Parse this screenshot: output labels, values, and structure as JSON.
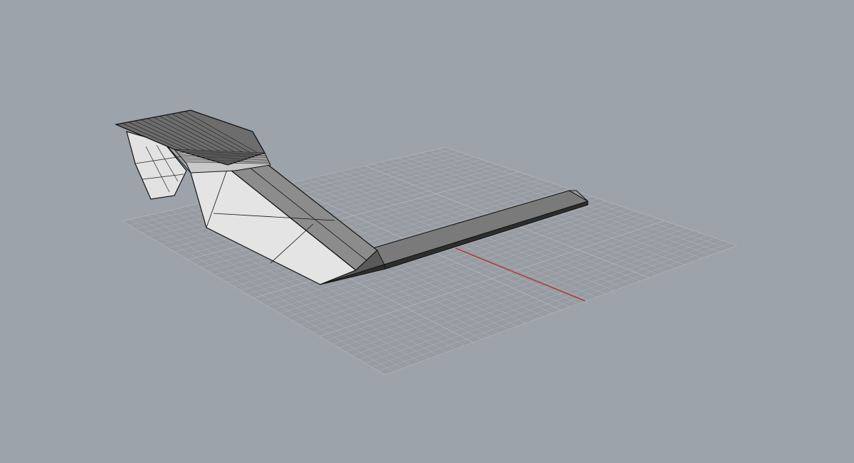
{
  "viewport": {
    "background": "#9ca3ab",
    "view": "perspective",
    "display_mode": "shaded"
  },
  "construction_plane": {
    "grid_visible": true,
    "grid_color": "#8a9097",
    "grid_line_color": "#b0b5bb",
    "plane_fill": "#959aa1"
  },
  "axes": {
    "x_axis_color": "#b03a3a"
  },
  "model": {
    "object": "polysurface",
    "face_light": "#e6e6e6",
    "face_dark": "#6e6e6e",
    "face_mid": "#8a8a8a",
    "edge_color": "#111111"
  }
}
